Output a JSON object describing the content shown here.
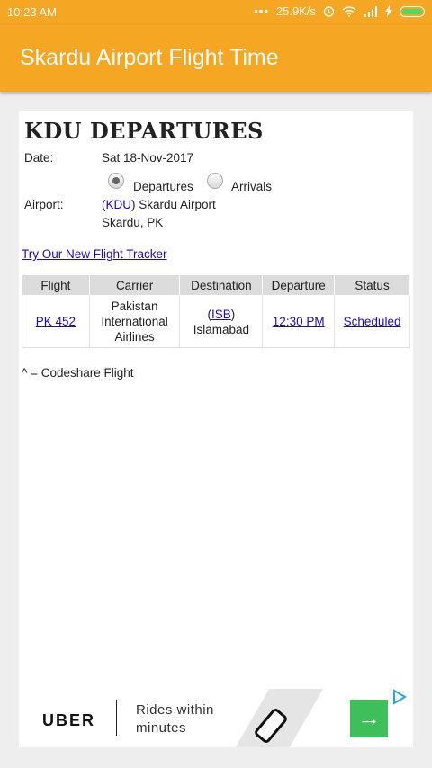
{
  "status_bar": {
    "time": "10:23 AM",
    "network_speed": "25.9K/s",
    "icons": [
      "dots-icon",
      "alarm-icon",
      "wifi-icon",
      "signal-icon",
      "charging-icon",
      "battery-icon"
    ]
  },
  "app_bar": {
    "title": "Skardu Airport Flight Time"
  },
  "page": {
    "title": "KDU DEPARTURES",
    "date_label": "Date:",
    "date_value": "Sat 18-Nov-2017",
    "radio_departures": "Departures",
    "radio_arrivals": "Arrivals",
    "selected_radio": "Departures",
    "airport_label": "Airport:",
    "airport_code": "KDU",
    "airport_name": "Skardu Airport",
    "airport_location": "Skardu, PK",
    "tracker_link": "Try Our New Flight Tracker",
    "codeshare_note": "^ = Codeshare Flight"
  },
  "table": {
    "headers": [
      "Flight",
      "Carrier",
      "Destination",
      "Departure",
      "Status"
    ],
    "rows": [
      {
        "flight": "PK 452",
        "carrier": [
          "Pakistan",
          "International",
          "Airlines"
        ],
        "dest_code": "ISB",
        "dest_name": "Islamabad",
        "departure": "12:30 PM",
        "status": "Scheduled"
      }
    ]
  },
  "ad": {
    "brand": "UBER",
    "line1": "Rides within",
    "line2": "minutes",
    "button_icon": "arrow-right-icon"
  },
  "colors": {
    "accent": "#f5a623",
    "link": "#1a0dab",
    "header_bg": "#dcdcdc",
    "ad_button": "#3fbf5a"
  }
}
